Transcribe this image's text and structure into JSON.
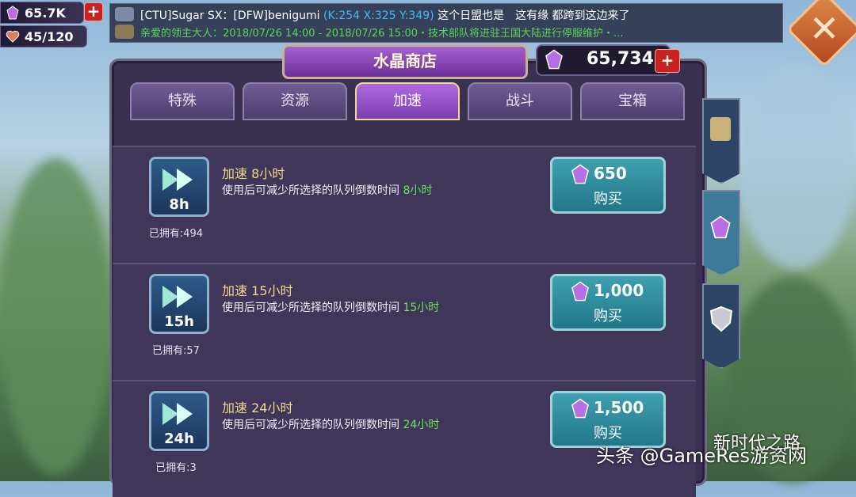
{
  "resources": {
    "crystals": "65.7K",
    "stamina": "45/120"
  },
  "chat": {
    "line1_prefix": "[CTU]Sugar SX：[DFW]benigumi",
    "line1_coords": "(K:254 X:325 Y:349)",
    "line1_msg": "这个日盟也是　这有缘 都跨到这边来了",
    "line2": "亲爱的领主大人：2018/07/26 14:00 - 2018/07/26 15:00・技术部队将进驻王国大陆进行停服维护・..."
  },
  "shop": {
    "title": "水晶商店",
    "balance": "65,734",
    "tabs": [
      "特殊",
      "资源",
      "加速",
      "战斗",
      "宝箱"
    ],
    "active_tab": "加速"
  },
  "items": [
    {
      "name": "加速 8小时",
      "desc": "使用后可减少所选择的队列倒数时间",
      "duration": "8小时",
      "badge": "8h",
      "owned": "已拥有:494",
      "price": "650",
      "buy_label": "购买"
    },
    {
      "name": "加速 15小时",
      "desc": "使用后可减少所选择的队列倒数时间",
      "duration": "15小时",
      "badge": "15h",
      "owned": "已拥有:57",
      "price": "1,000",
      "buy_label": "购买"
    },
    {
      "name": "加速 24小时",
      "desc": "使用后可减少所选择的队列倒数时间",
      "duration": "24小时",
      "badge": "24h",
      "owned": "已拥有:3",
      "price": "1,500",
      "buy_label": "购买"
    }
  ],
  "watermarks": {
    "left": "头条 @GameRes游资网",
    "right": "新时代之路"
  },
  "colors": {
    "accent": "#a561d1",
    "price_green": "#6be35a",
    "buy_button": "#2f8f9f"
  }
}
